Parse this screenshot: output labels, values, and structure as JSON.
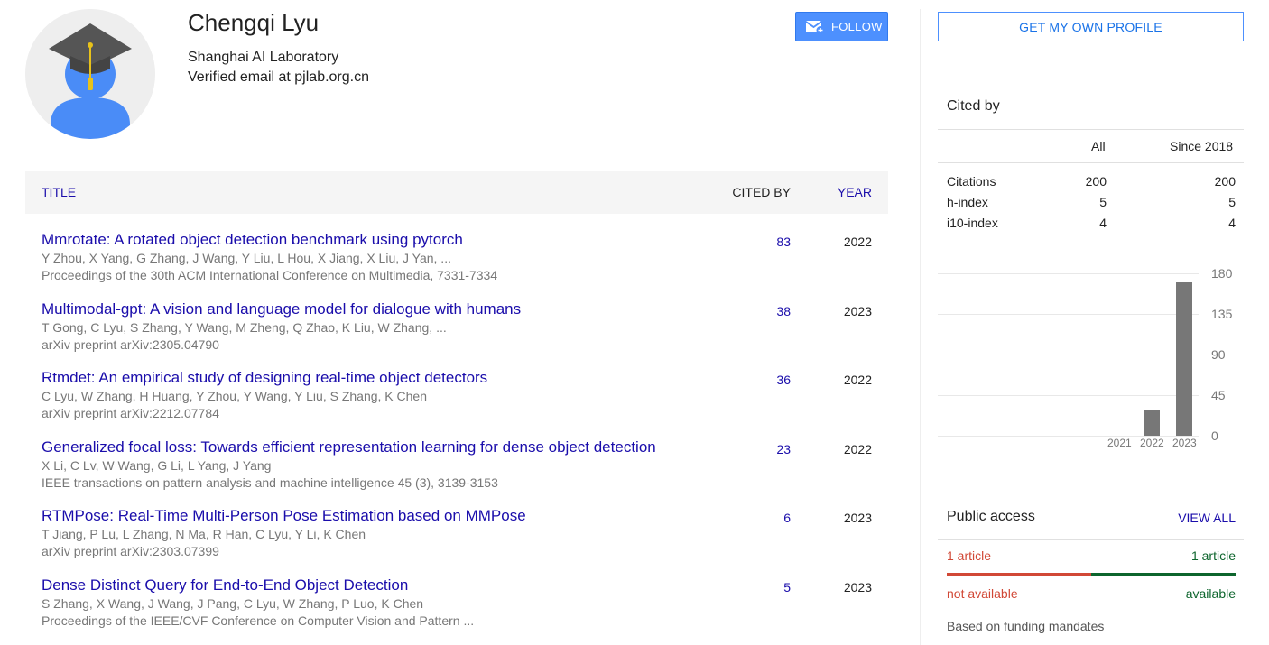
{
  "profile": {
    "name": "Chengqi Lyu",
    "affiliation": "Shanghai AI Laboratory",
    "email": "Verified email at pjlab.org.cn",
    "follow_label": "FOLLOW"
  },
  "table": {
    "col_title": "TITLE",
    "col_cited": "CITED BY",
    "col_year": "YEAR",
    "rows": [
      {
        "title": "Mmrotate: A rotated object detection benchmark using pytorch",
        "authors": "Y Zhou, X Yang, G Zhang, J Wang, Y Liu, L Hou, X Jiang, X Liu, J Yan, ...",
        "venue": "Proceedings of the 30th ACM International Conference on Multimedia, 7331-7334",
        "cited": "83",
        "year": "2022"
      },
      {
        "title": "Multimodal-gpt: A vision and language model for dialogue with humans",
        "authors": "T Gong, C Lyu, S Zhang, Y Wang, M Zheng, Q Zhao, K Liu, W Zhang, ...",
        "venue": "arXiv preprint arXiv:2305.04790",
        "cited": "38",
        "year": "2023"
      },
      {
        "title": "Rtmdet: An empirical study of designing real-time object detectors",
        "authors": "C Lyu, W Zhang, H Huang, Y Zhou, Y Wang, Y Liu, S Zhang, K Chen",
        "venue": "arXiv preprint arXiv:2212.07784",
        "cited": "36",
        "year": "2022"
      },
      {
        "title": "Generalized focal loss: Towards efficient representation learning for dense object detection",
        "authors": "X Li, C Lv, W Wang, G Li, L Yang, J Yang",
        "venue": "IEEE transactions on pattern analysis and machine intelligence 45 (3), 3139-3153",
        "cited": "23",
        "year": "2022"
      },
      {
        "title": "RTMPose: Real-Time Multi-Person Pose Estimation based on MMPose",
        "authors": "T Jiang, P Lu, L Zhang, N Ma, R Han, C Lyu, Y Li, K Chen",
        "venue": "arXiv preprint arXiv:2303.07399",
        "cited": "6",
        "year": "2023"
      },
      {
        "title": "Dense Distinct Query for End-to-End Object Detection",
        "authors": "S Zhang, X Wang, J Wang, J Pang, C Lyu, W Zhang, P Luo, K Chen",
        "venue": "Proceedings of the IEEE/CVF Conference on Computer Vision and Pattern ...",
        "cited": "5",
        "year": "2023"
      }
    ]
  },
  "sidebar": {
    "own_profile_label": "GET MY OWN PROFILE",
    "cited_by_title": "Cited by",
    "col_all": "All",
    "col_since": "Since 2018",
    "metrics": [
      {
        "label": "Citations",
        "all": "200",
        "since": "200"
      },
      {
        "label": "h-index",
        "all": "5",
        "since": "5"
      },
      {
        "label": "i10-index",
        "all": "4",
        "since": "4"
      }
    ],
    "public_access": {
      "title": "Public access",
      "view_all": "VIEW ALL",
      "left_count": "1 article",
      "right_count": "1 article",
      "not_available": "not available",
      "available": "available",
      "funding": "Based on funding mandates",
      "available_fraction": 0.5,
      "colors": {
        "not_available": "#d14836",
        "available": "#0d652d"
      }
    }
  },
  "chart_data": {
    "type": "bar",
    "categories": [
      "2021",
      "2022",
      "2023"
    ],
    "values": [
      0,
      28,
      170
    ],
    "ylim": [
      0,
      180
    ],
    "yticks": [
      "180",
      "135",
      "90",
      "45",
      "0"
    ],
    "grid": true
  }
}
